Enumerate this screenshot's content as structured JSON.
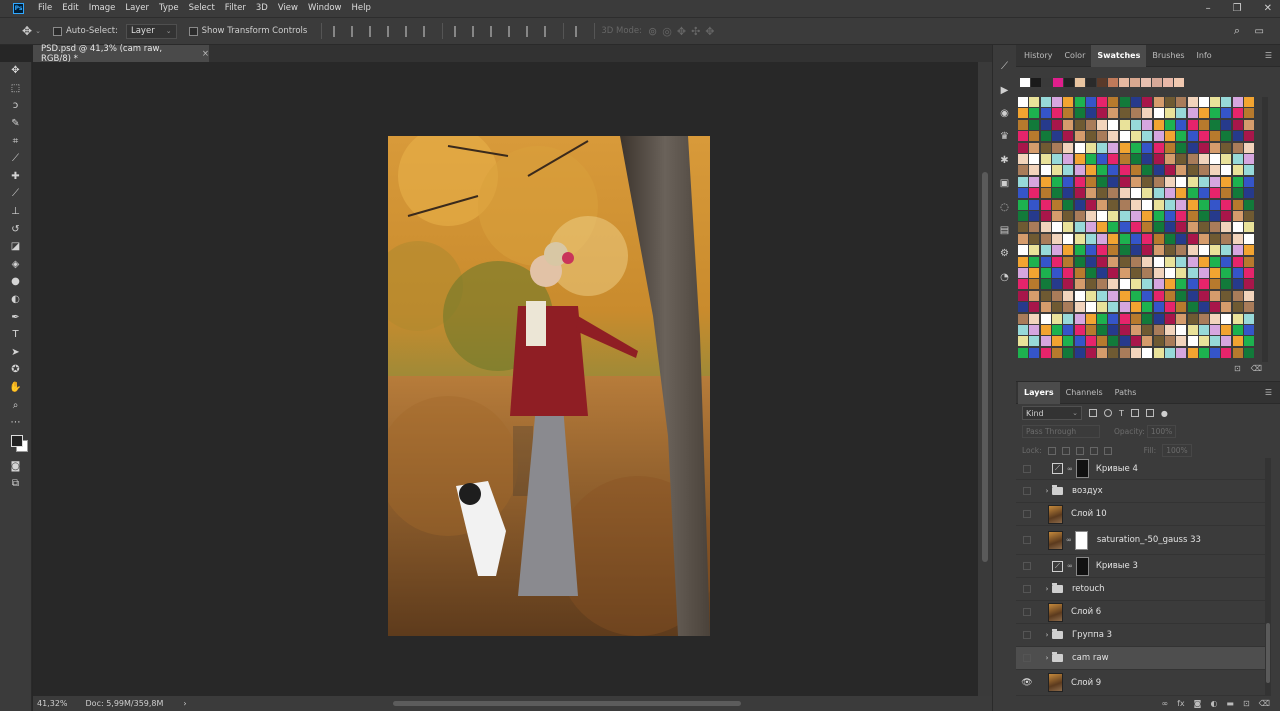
{
  "menubar": {
    "logo": "Ps",
    "items": [
      "File",
      "Edit",
      "Image",
      "Layer",
      "Type",
      "Select",
      "Filter",
      "3D",
      "View",
      "Window",
      "Help"
    ],
    "window_controls": [
      "–",
      "❐",
      "✕"
    ]
  },
  "options": {
    "auto_select_label": "Auto-Select:",
    "auto_select_value": "Layer",
    "show_transform_label": "Show Transform Controls",
    "mode_label": "3D Mode:"
  },
  "document": {
    "tab_title": "PSD.psd @ 41,3% (cam raw, RGB/8) *",
    "close": "×"
  },
  "status": {
    "zoom": "41,32%",
    "doc_info": "Doc: 5,99M/359,8M",
    "arrow": "›"
  },
  "top_panel": {
    "tabs": [
      "History",
      "Color",
      "Swatches",
      "Brushes",
      "Info"
    ],
    "active_tab": "Swatches",
    "menu": "☰"
  },
  "layers_panel": {
    "tabs": [
      "Layers",
      "Channels",
      "Paths"
    ],
    "active_tab": "Layers",
    "menu": "☰",
    "filter_kind": "Kind",
    "blend_mode": "Pass Through",
    "opacity_label": "Opacity:",
    "opacity_value": "100%",
    "lock_label": "Lock:",
    "fill_label": "Fill:",
    "fill_value": "100%",
    "layers": [
      {
        "name": "Кривые 4",
        "kind": "adjustment",
        "mask": "dark",
        "visible": false
      },
      {
        "name": "воздух",
        "kind": "group",
        "visible": false
      },
      {
        "name": "Слой 10",
        "kind": "pixel",
        "visible": false
      },
      {
        "name": "saturation_-50_gauss 33",
        "kind": "pixel-mask",
        "mask": "white",
        "visible": false
      },
      {
        "name": "Кривые 3",
        "kind": "adjustment",
        "mask": "dark",
        "visible": false
      },
      {
        "name": "retouch",
        "kind": "group",
        "visible": false
      },
      {
        "name": "Слой 6",
        "kind": "pixel",
        "visible": false
      },
      {
        "name": "Группа 3",
        "kind": "group",
        "visible": false
      },
      {
        "name": "cam raw",
        "kind": "group",
        "visible": false,
        "selected": true
      },
      {
        "name": "Слой 9",
        "kind": "pixel",
        "visible": true
      }
    ]
  },
  "colors": {
    "accent": "#31a8ff",
    "panel_bg": "#3b3b3b",
    "canvas_bg": "#282828"
  }
}
